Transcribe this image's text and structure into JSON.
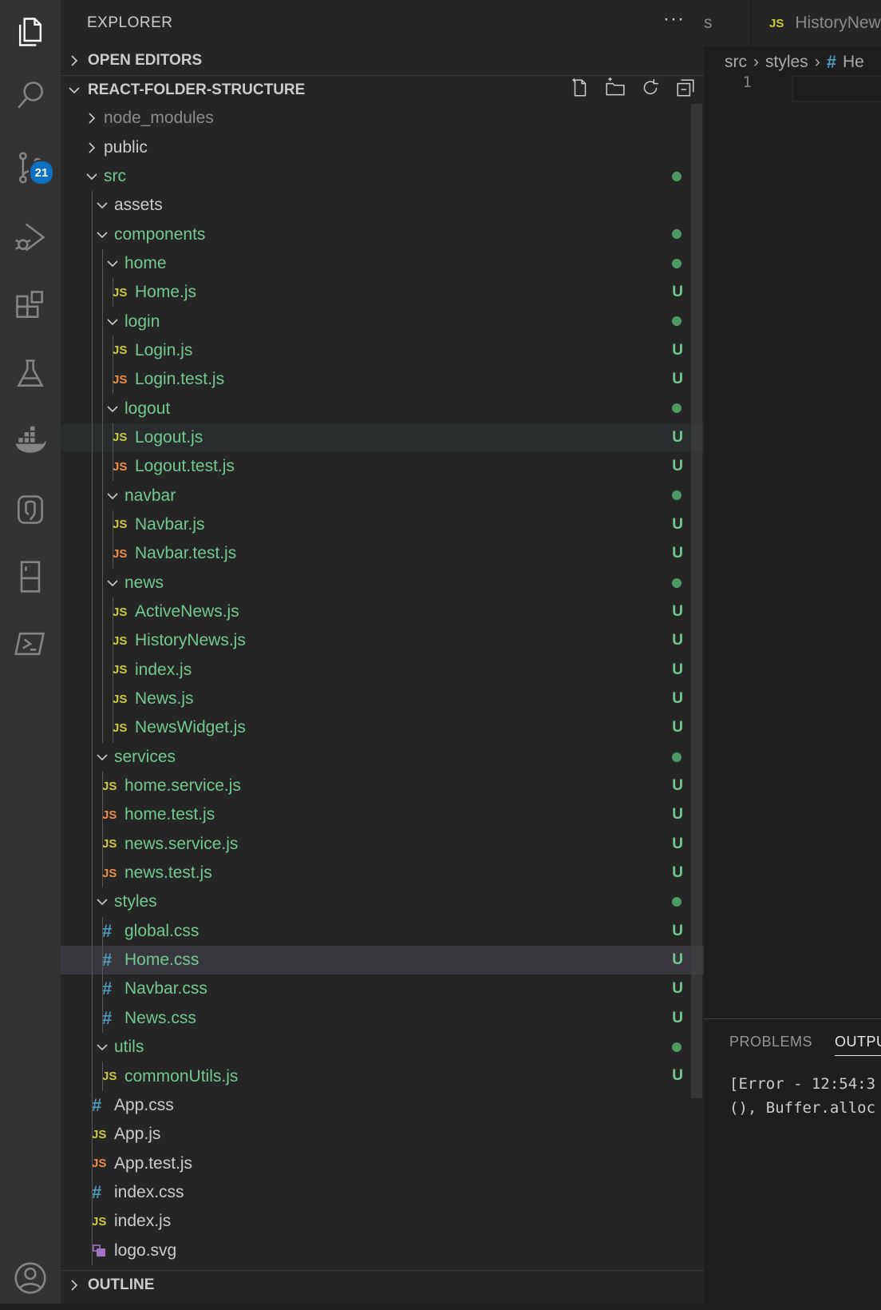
{
  "explorer": {
    "title": "EXPLORER",
    "more": "···",
    "open_editors": "OPEN EDITORS",
    "project": "REACT-FOLDER-STRUCTURE",
    "outline": "OUTLINE"
  },
  "activity": {
    "source_control_badge": "21"
  },
  "tree": [
    {
      "name": "node_modules",
      "depth": 0,
      "kind": "folder",
      "open": false,
      "color": "dim"
    },
    {
      "name": "public",
      "depth": 0,
      "kind": "folder",
      "open": false,
      "color": "plain"
    },
    {
      "name": "src",
      "depth": 0,
      "kind": "folder",
      "open": true,
      "color": "git-green",
      "status": "dot"
    },
    {
      "name": "assets",
      "depth": 1,
      "kind": "folder",
      "open": true,
      "color": "plain"
    },
    {
      "name": "components",
      "depth": 1,
      "kind": "folder",
      "open": true,
      "color": "git-green",
      "status": "dot"
    },
    {
      "name": "home",
      "depth": 2,
      "kind": "folder",
      "open": true,
      "color": "git-green",
      "status": "dot"
    },
    {
      "name": "Home.js",
      "depth": 3,
      "kind": "js",
      "color": "git-green",
      "status": "U"
    },
    {
      "name": "login",
      "depth": 2,
      "kind": "folder",
      "open": true,
      "color": "git-green",
      "status": "dot"
    },
    {
      "name": "Login.js",
      "depth": 3,
      "kind": "js",
      "color": "git-green",
      "status": "U"
    },
    {
      "name": "Login.test.js",
      "depth": 3,
      "kind": "test",
      "color": "git-green",
      "status": "U"
    },
    {
      "name": "logout",
      "depth": 2,
      "kind": "folder",
      "open": true,
      "color": "git-green",
      "status": "dot"
    },
    {
      "name": "Logout.js",
      "depth": 3,
      "kind": "js",
      "color": "git-green",
      "status": "U",
      "state": "hover"
    },
    {
      "name": "Logout.test.js",
      "depth": 3,
      "kind": "test",
      "color": "git-green",
      "status": "U"
    },
    {
      "name": "navbar",
      "depth": 2,
      "kind": "folder",
      "open": true,
      "color": "git-green",
      "status": "dot"
    },
    {
      "name": "Navbar.js",
      "depth": 3,
      "kind": "js",
      "color": "git-green",
      "status": "U"
    },
    {
      "name": "Navbar.test.js",
      "depth": 3,
      "kind": "test",
      "color": "git-green",
      "status": "U"
    },
    {
      "name": "news",
      "depth": 2,
      "kind": "folder",
      "open": true,
      "color": "git-green",
      "status": "dot"
    },
    {
      "name": "ActiveNews.js",
      "depth": 3,
      "kind": "js",
      "color": "git-green",
      "status": "U"
    },
    {
      "name": "HistoryNews.js",
      "depth": 3,
      "kind": "js",
      "color": "git-green",
      "status": "U"
    },
    {
      "name": "index.js",
      "depth": 3,
      "kind": "js",
      "color": "git-green",
      "status": "U"
    },
    {
      "name": "News.js",
      "depth": 3,
      "kind": "js",
      "color": "git-green",
      "status": "U"
    },
    {
      "name": "NewsWidget.js",
      "depth": 3,
      "kind": "js",
      "color": "git-green",
      "status": "U"
    },
    {
      "name": "services",
      "depth": 1,
      "kind": "folder",
      "open": true,
      "color": "git-green",
      "status": "dot"
    },
    {
      "name": "home.service.js",
      "depth": 2,
      "kind": "js",
      "color": "git-green",
      "status": "U"
    },
    {
      "name": "home.test.js",
      "depth": 2,
      "kind": "test",
      "color": "git-green",
      "status": "U"
    },
    {
      "name": "news.service.js",
      "depth": 2,
      "kind": "js",
      "color": "git-green",
      "status": "U"
    },
    {
      "name": "news.test.js",
      "depth": 2,
      "kind": "test",
      "color": "git-green",
      "status": "U"
    },
    {
      "name": "styles",
      "depth": 1,
      "kind": "folder",
      "open": true,
      "color": "git-green",
      "status": "dot"
    },
    {
      "name": "global.css",
      "depth": 2,
      "kind": "css",
      "color": "git-green",
      "status": "U"
    },
    {
      "name": "Home.css",
      "depth": 2,
      "kind": "css",
      "color": "git-green",
      "status": "U",
      "state": "selected"
    },
    {
      "name": "Navbar.css",
      "depth": 2,
      "kind": "css",
      "color": "git-green",
      "status": "U"
    },
    {
      "name": "News.css",
      "depth": 2,
      "kind": "css",
      "color": "git-green",
      "status": "U"
    },
    {
      "name": "utils",
      "depth": 1,
      "kind": "folder",
      "open": true,
      "color": "git-green",
      "status": "dot"
    },
    {
      "name": "commonUtils.js",
      "depth": 2,
      "kind": "js",
      "color": "git-green",
      "status": "U"
    },
    {
      "name": "App.css",
      "depth": 1,
      "kind": "css",
      "color": "plain"
    },
    {
      "name": "App.js",
      "depth": 1,
      "kind": "js",
      "color": "plain"
    },
    {
      "name": "App.test.js",
      "depth": 1,
      "kind": "test",
      "color": "plain"
    },
    {
      "name": "index.css",
      "depth": 1,
      "kind": "css",
      "color": "plain"
    },
    {
      "name": "index.js",
      "depth": 1,
      "kind": "js",
      "color": "plain"
    },
    {
      "name": "logo.svg",
      "depth": 1,
      "kind": "svg",
      "color": "plain"
    }
  ],
  "file_badges": {
    "js": "JS",
    "css": "#"
  },
  "editor": {
    "tab_partial": "s",
    "tab_label": "HistoryNew",
    "tab_icon": "JS",
    "breadcrumb": [
      "src",
      "styles",
      "He"
    ],
    "breadcrumb_hash": "#",
    "line_number": "1"
  },
  "panel": {
    "tabs": [
      "PROBLEMS",
      "OUTPU"
    ],
    "lines": [
      "[Error - 12:54:3",
      "(), Buffer.alloc"
    ]
  }
}
